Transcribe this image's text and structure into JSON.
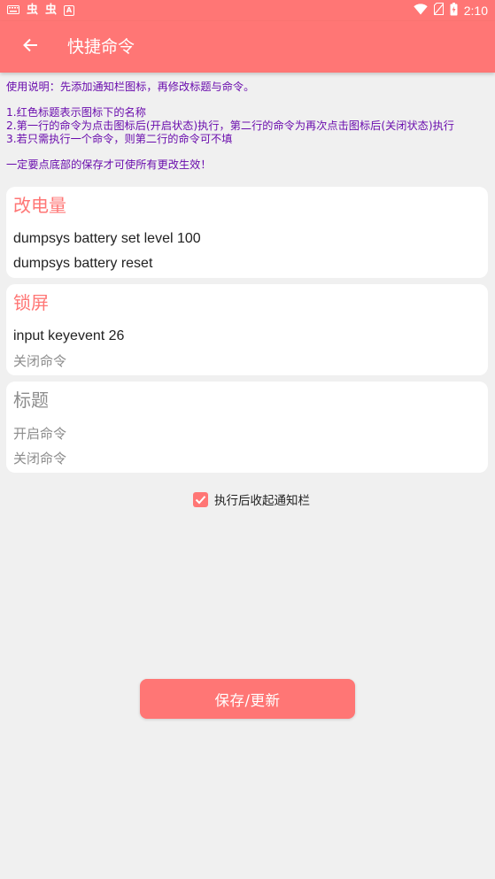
{
  "status_bar": {
    "time": "2:10",
    "left_icons": [
      "keyboard-icon",
      "bug-icon",
      "bug-icon",
      "app-notification-icon"
    ],
    "right_icons": [
      "wifi-icon",
      "no-sim-icon",
      "battery-icon"
    ],
    "bug_glyph": "虫",
    "notif_glyph": "A",
    "color": "#ff7675"
  },
  "app_bar": {
    "title": "快捷命令",
    "back_icon": "arrow-left-icon",
    "color": "#ff7675"
  },
  "instructions": {
    "line1": "使用说明：先添加通知栏图标，再修改标题与命令。",
    "line2": "1.红色标题表示图标下的名称",
    "line3": "2.第一行的命令为点击图标后(开启状态)执行，第二行的命令为再次点击图标后(关闭状态)执行",
    "line4": "3.若只需执行一个命令，则第二行的命令可不填",
    "line5": "一定要点底部的保存才可使所有更改生效！",
    "color": "#6a0dad"
  },
  "cards": [
    {
      "title": "改电量",
      "on_command": "dumpsys battery set level 100",
      "off_command": "dumpsys battery reset"
    },
    {
      "title": "锁屏",
      "on_command": "input keyevent 26",
      "off_command": "关闭命令"
    },
    {
      "title": "标题",
      "on_command": "开启命令",
      "off_command": "关闭命令"
    }
  ],
  "collapse_checkbox": {
    "label": "执行后收起通知栏",
    "checked": true
  },
  "save_button": {
    "label": "保存/更新"
  }
}
